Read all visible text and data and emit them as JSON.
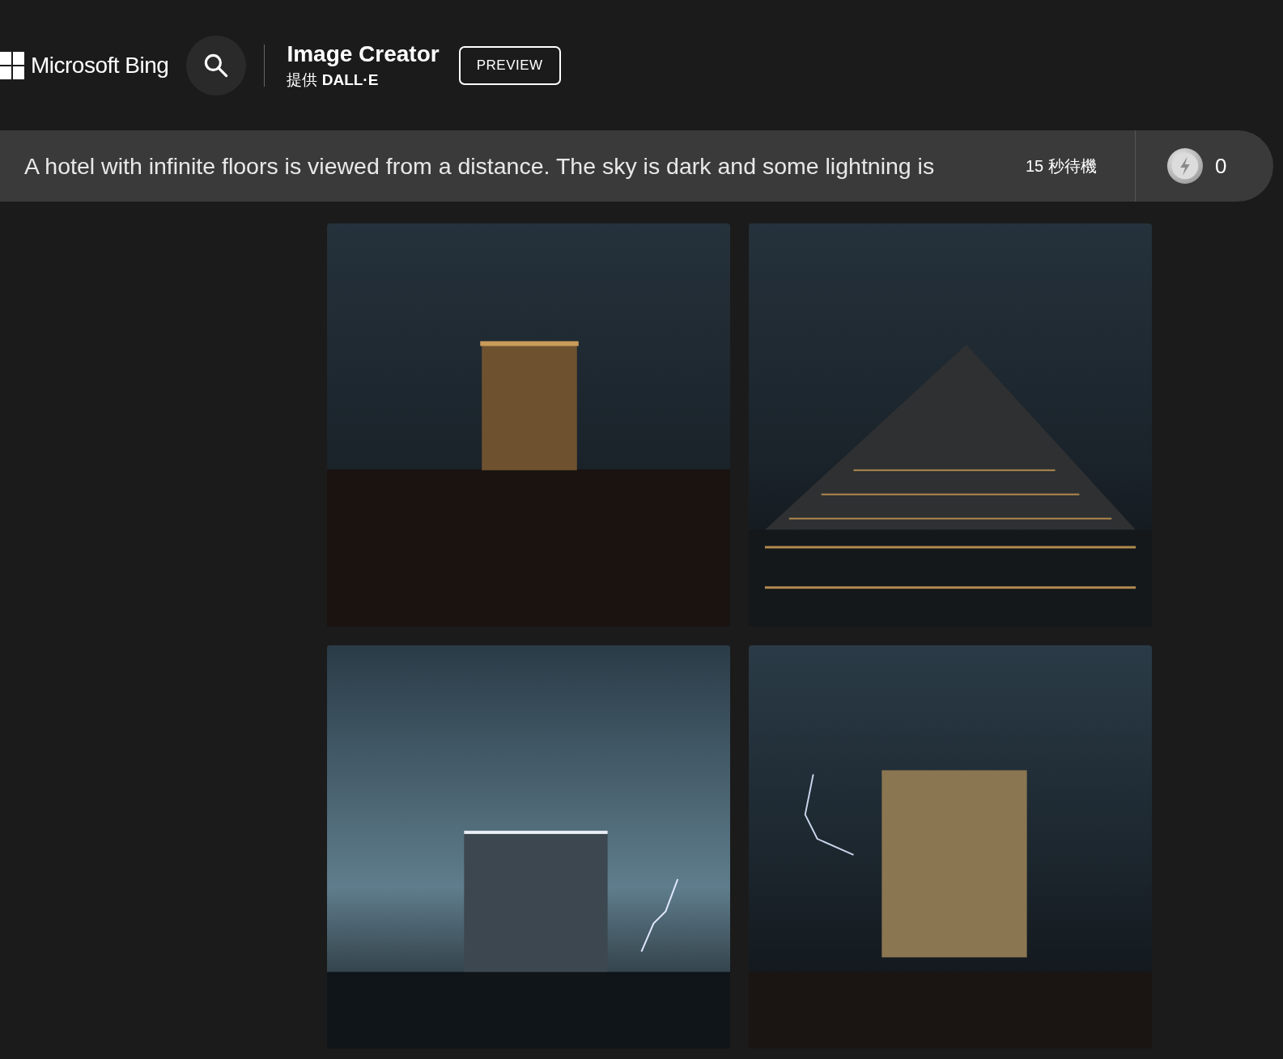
{
  "header": {
    "brand": "Microsoft Bing",
    "title": "Image Creator",
    "subtitle": "提供 **DALL·E**",
    "badge": "PREVIEW"
  },
  "prompt_bar": {
    "prompt": "A hotel with infinite floors is viewed from a distance. The sky is dark and some lightning is",
    "wait": "15 秒待機",
    "boosts": "0"
  },
  "images": [
    {
      "kind": "tower-small"
    },
    {
      "kind": "pyramid"
    },
    {
      "kind": "tower-wide"
    },
    {
      "kind": "tower-lightning"
    }
  ]
}
